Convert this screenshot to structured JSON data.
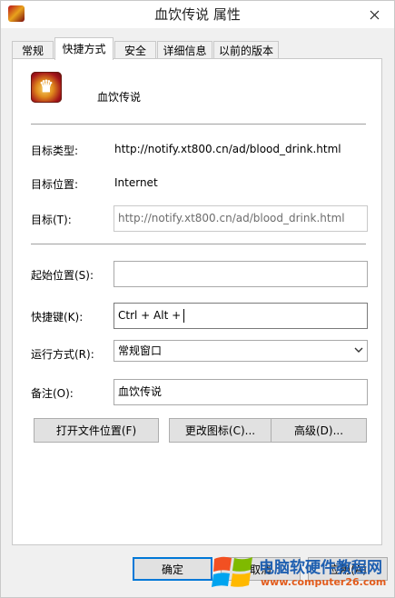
{
  "window": {
    "title": "血饮传说 属性",
    "close_glyph": "✕"
  },
  "tabs": [
    {
      "label": "常规",
      "active": false
    },
    {
      "label": "快捷方式",
      "active": true
    },
    {
      "label": "安全",
      "active": false
    },
    {
      "label": "详细信息",
      "active": false
    },
    {
      "label": "以前的版本",
      "active": false
    }
  ],
  "shortcut": {
    "app_name": "血饮传说",
    "target_type_label": "目标类型:",
    "target_type_value": "http://notify.xt800.cn/ad/blood_drink.html",
    "target_location_label": "目标位置:",
    "target_location_value": "Internet",
    "target_label": "目标(T):",
    "target_value": "http://notify.xt800.cn/ad/blood_drink.html",
    "start_in_label": "起始位置(S):",
    "start_in_value": "",
    "hotkey_label": "快捷键(K):",
    "hotkey_value": "Ctrl + Alt +",
    "run_label": "运行方式(R):",
    "run_value": "常规窗口",
    "comment_label": "备注(O):",
    "comment_value": "血饮传说"
  },
  "buttons": {
    "open_location": "打开文件位置(F)",
    "change_icon": "更改图标(C)...",
    "advanced": "高级(D)...",
    "ok": "确定",
    "cancel": "取消",
    "apply": "应用(A)"
  },
  "watermark": {
    "line1": "电脑软硬件教程网",
    "line2": "www.computer26.com"
  },
  "colors": {
    "accent": "#0078d7",
    "watermark_blue": "#1e5fb0",
    "watermark_orange": "#e25b1b"
  },
  "icons": {
    "app": "blood-drink-game-icon",
    "close": "close-icon",
    "dropdown": "chevron-down-icon"
  }
}
